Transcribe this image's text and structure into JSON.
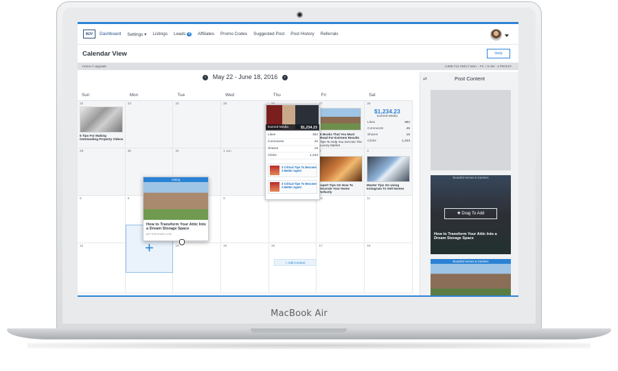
{
  "device": {
    "brand_label": "MacBook Air"
  },
  "nav": {
    "logo": "MJV",
    "items": [
      {
        "label": "Dashboard"
      },
      {
        "label": "Settings ▾"
      },
      {
        "label": "Listings"
      },
      {
        "label": "Leads",
        "badge": "4"
      },
      {
        "label": "Affiliates"
      },
      {
        "label": "Promo Codes"
      },
      {
        "label": "Suggested Post"
      },
      {
        "label": "Post History"
      },
      {
        "label": "Referrals"
      }
    ]
  },
  "page": {
    "title": "Calendar View",
    "help_label": "Help",
    "breadcrumb": "Home // Upgrade",
    "contact": "1.808.712.7600 // Mon. - Fri. / 9 AM - 4 PM EST"
  },
  "calendar": {
    "range": "May 22 - June 18, 2016",
    "prev_icon": "‹",
    "next_icon": "›",
    "day_names": [
      "Sun",
      "Mon",
      "Tue",
      "Wed",
      "Thu",
      "Fri",
      "Sat"
    ],
    "weeks": [
      [
        "22",
        "23",
        "24",
        "25",
        "26",
        "27",
        "28"
      ],
      [
        "29",
        "30",
        "31",
        "1 Jun",
        "2",
        "3",
        "4"
      ],
      [
        "5",
        "6",
        "7",
        "8",
        "9",
        "10",
        "11"
      ],
      [
        "12",
        "13",
        "14",
        "15",
        "16",
        "17",
        "18"
      ]
    ],
    "posts": {
      "sun_vintage": "5 Tips For Making Outstanding Property Videos",
      "fri_house": "6 Books That You Must Read For Extreme Results",
      "fri_interior": "Expert Tips On How To Decorate Your Home Perfectly",
      "sat_phone": "Master Tips On Using Instagram To Sell Homes",
      "thu_mini_1": "3 Critical Tips To Become A Better Agent",
      "thu_mini_2": "3 Critical Tips To Become A Better Agent"
    },
    "fri_caption2": "Tips To Help You Get Into The Luxury Market",
    "sat_stats": {
      "earned": "$1,234.23",
      "earned_label": "Earned Media",
      "rows": [
        {
          "label": "Likes",
          "value": "382"
        },
        {
          "label": "Comments",
          "value": "45"
        },
        {
          "label": "Shares",
          "value": "18"
        },
        {
          "label": "Clicks",
          "value": "1,343"
        }
      ]
    },
    "popup": {
      "header_label": "Earned Media",
      "header_value": "$1,234.23",
      "rows": [
        {
          "label": "Likes",
          "value": "382"
        },
        {
          "label": "Comments",
          "value": "45"
        },
        {
          "label": "Shares",
          "value": "18"
        },
        {
          "label": "Clicks",
          "value": "1,343"
        }
      ]
    },
    "drag_card": {
      "tag": "Listing",
      "title": "How to Transform Your Attic Into a Dream Storage Space",
      "source": "BETTERHOMES.COM"
    },
    "add_content": "+ Add Content"
  },
  "right_panel": {
    "title": "Post Content",
    "card2_tag": "Beautiful Homes & Gardens",
    "drag_label": "✚ Drag To Add",
    "card2_title": "How to Transform Your Attic Into a Dream Storage Space",
    "card3_tag": "Beautiful Homes & Gardens"
  },
  "colors": {
    "accent": "#2a82d4",
    "text": "#2e3640"
  }
}
